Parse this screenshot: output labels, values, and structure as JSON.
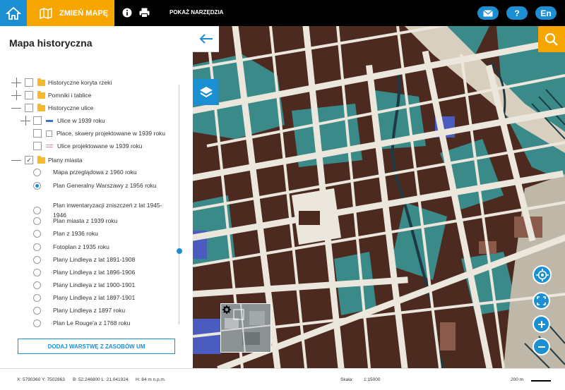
{
  "topbar": {
    "change_map_label": "ZMIEŃ MAPĘ",
    "tools_label": "POKAŻ NARZĘDZIA",
    "language_label": "En",
    "help_label": "?"
  },
  "panel": {
    "title": "Mapa historyczna",
    "add_layer_label": "DODAJ WARSTWĘ Z ZASOBÓW UM",
    "layers": [
      {
        "label": "Historyczne koryta rzeki",
        "checked": false
      },
      {
        "label": "Pomniki i tablice",
        "checked": false
      },
      {
        "label": "Historyczne ulice",
        "checked": false
      },
      {
        "label": "Ulice w 1939 roku",
        "checked": false
      },
      {
        "label": "Place, skwery projektowane w 1939 roku",
        "checked": false
      },
      {
        "label": "Ulice projektowane w 1939 roku",
        "checked": false
      },
      {
        "label": "Plany miasta",
        "checked": true
      }
    ],
    "plans": [
      {
        "label": "Mapa przeglądowa z 1960 roku",
        "selected": false
      },
      {
        "label": "Plan Generalny Warszawy z 1956 roku",
        "selected": true
      },
      {
        "label": "Plan inwentaryzacji zniszczeń z lat 1945-",
        "label2": "1946",
        "selected": false
      },
      {
        "label": "Plan miasta z 1939 roku",
        "selected": false
      },
      {
        "label": "Plan z 1936 roku",
        "selected": false
      },
      {
        "label": "Fotoplan z 1935 roku",
        "selected": false
      },
      {
        "label": "Plany Lindleya z lat 1891-1908",
        "selected": false
      },
      {
        "label": "Plany Lindleya z lat 1896-1906",
        "selected": false
      },
      {
        "label": "Plany Lindleya z lat 1900-1901",
        "selected": false
      },
      {
        "label": "Plany Lindleya z lat 1897-1901",
        "selected": false
      },
      {
        "label": "Plany Lindleya z 1897 roku",
        "selected": false
      },
      {
        "label": "Plan Le Rouge'a z 1768 roku",
        "selected": false
      }
    ]
  },
  "status": {
    "xy": "X: 5790360 Y: 7502863",
    "bl": "B: 52.246800 L: 21.041924",
    "h": "H: 84 m n.p.m.",
    "scale_label": "Skala:",
    "scale_value": "1:15000",
    "scale_bar": "200 m"
  },
  "colors": {
    "accent": "#1c8fd3",
    "orange": "#f7a600",
    "map_brown": "#4c2a1f",
    "map_teal": "#3a8a8a",
    "map_road": "#e8e4dc"
  }
}
